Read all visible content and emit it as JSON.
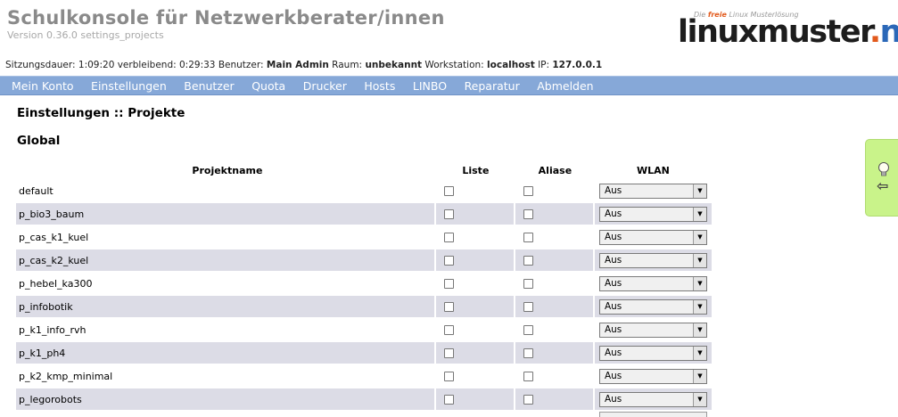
{
  "header": {
    "title": "Schulkonsole für Netzwerkberater/innen",
    "version": "Version 0.36.0 settings_projects",
    "logo": {
      "tag_prefix": "Die",
      "tag_highlight": "freie",
      "tag_suffix": "Linux Musterlösung",
      "main": "linuxmuster",
      "dot": ".",
      "net": "net"
    }
  },
  "session": {
    "duration_label": "Sitzungsdauer:",
    "duration": "1:09:20",
    "remaining_label": "verbleibend:",
    "remaining": "0:29:33",
    "user_label": "Benutzer:",
    "user": "Main Admin",
    "room_label": "Raum:",
    "room": "unbekannt",
    "workstation_label": "Workstation:",
    "workstation": "localhost",
    "ip_label": "IP:",
    "ip": "127.0.0.1"
  },
  "nav": {
    "items": [
      "Mein Konto",
      "Einstellungen",
      "Benutzer",
      "Quota",
      "Drucker",
      "Hosts",
      "LINBO",
      "Reparatur",
      "Abmelden"
    ]
  },
  "page": {
    "title": "Einstellungen :: Projekte",
    "section": "Global"
  },
  "table": {
    "headers": [
      "Projektname",
      "Liste",
      "Aliase",
      "WLAN"
    ],
    "rows": [
      {
        "name": "default",
        "liste": false,
        "aliase": false,
        "wlan": "Aus"
      },
      {
        "name": "p_bio3_baum",
        "liste": false,
        "aliase": false,
        "wlan": "Aus"
      },
      {
        "name": "p_cas_k1_kuel",
        "liste": false,
        "aliase": false,
        "wlan": "Aus"
      },
      {
        "name": "p_cas_k2_kuel",
        "liste": false,
        "aliase": false,
        "wlan": "Aus"
      },
      {
        "name": "p_hebel_ka300",
        "liste": false,
        "aliase": false,
        "wlan": "Aus"
      },
      {
        "name": "p_infobotik",
        "liste": false,
        "aliase": false,
        "wlan": "Aus"
      },
      {
        "name": "p_k1_info_rvh",
        "liste": false,
        "aliase": false,
        "wlan": "Aus"
      },
      {
        "name": "p_k1_ph4",
        "liste": false,
        "aliase": false,
        "wlan": "Aus"
      },
      {
        "name": "p_k2_kmp_minimal",
        "liste": false,
        "aliase": false,
        "wlan": "Aus"
      },
      {
        "name": "p_legorobots",
        "liste": false,
        "aliase": false,
        "wlan": "Aus"
      }
    ]
  },
  "icons": {
    "dropdown": "chevron-down-icon",
    "help": "lightbulb-icon",
    "collapse": "arrow-left-icon"
  },
  "colors": {
    "navbar": "#86a8d8",
    "row_alt": "#dcdce6",
    "side_panel": "#c9f38a",
    "logo_accent": "#e25a1c",
    "logo_net": "#2b68b8"
  }
}
